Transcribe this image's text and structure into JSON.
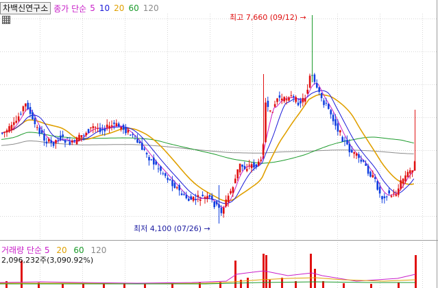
{
  "stock_name": "차백신연구소",
  "price_legend": {
    "label": "종가 단순",
    "periods": [
      {
        "text": "5",
        "color": "#c81dc8"
      },
      {
        "text": "10",
        "color": "#1a1ad8"
      },
      {
        "text": "20",
        "color": "#e0a000"
      },
      {
        "text": "60",
        "color": "#1a9a2a"
      },
      {
        "text": "120",
        "color": "#8a8a8a"
      }
    ]
  },
  "annotations": {
    "high_label": "최고 7,660 (09/12)",
    "high_arrow": "→",
    "low_label": "최저 4,100 (07/26)",
    "low_arrow": "→"
  },
  "volume_legend": {
    "label": "거래량 단순",
    "periods": [
      {
        "text": "5",
        "color": "#c81dc8"
      },
      {
        "text": "20",
        "color": "#e0a000"
      },
      {
        "text": "60",
        "color": "#1a9a2a"
      },
      {
        "text": "120",
        "color": "#8a8a8a"
      }
    ],
    "detail": "2,096,232주(3,090.92%)"
  },
  "colors": {
    "up": "#e01010",
    "down": "#1040e0",
    "ma5": "#c81dc8",
    "ma10": "#1a1ad8",
    "ma20": "#e0a000",
    "ma60": "#1a9a2a",
    "ma120": "#8a8a8a",
    "grid": "#d6d6d6"
  },
  "icons": {
    "calculator": "calculator-icon"
  }
}
